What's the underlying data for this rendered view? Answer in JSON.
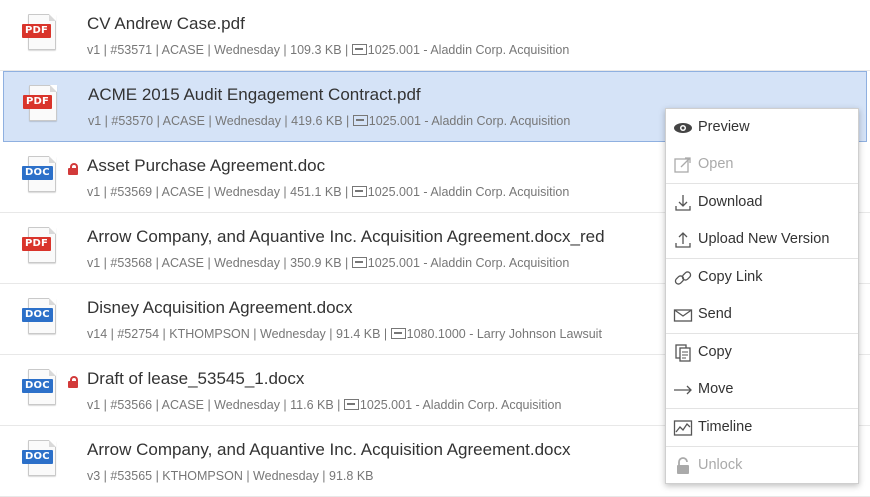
{
  "files": [
    {
      "badge": "PDF",
      "type": "pdf",
      "locked": false,
      "selected": false,
      "title": "CV Andrew Case.pdf",
      "meta_pre": "v1 | #53571 | ACASE | Wednesday | 109.3 KB | ",
      "meta_post": "1025.001 - Aladdin Corp. Acquisition"
    },
    {
      "badge": "PDF",
      "type": "pdf",
      "locked": false,
      "selected": true,
      "title": "ACME 2015 Audit Engagement Contract.pdf",
      "meta_pre": "v1 | #53570 | ACASE | Wednesday | 419.6 KB | ",
      "meta_post": "1025.001 - Aladdin Corp. Acquisition"
    },
    {
      "badge": "DOC",
      "type": "doc",
      "locked": true,
      "selected": false,
      "title": "Asset Purchase Agreement.doc",
      "meta_pre": "v1 | #53569 | ACASE | Wednesday | 451.1 KB | ",
      "meta_post": "1025.001 - Aladdin Corp. Acquisition"
    },
    {
      "badge": "PDF",
      "type": "pdf",
      "locked": false,
      "selected": false,
      "title": "Arrow Company, and Aquantive Inc. Acquisition Agreement.docx_red",
      "meta_pre": "v1 | #53568 | ACASE | Wednesday | 350.9 KB | ",
      "meta_post": "1025.001 - Aladdin Corp. Acquisition"
    },
    {
      "badge": "DOC",
      "type": "doc",
      "locked": false,
      "selected": false,
      "title": "Disney Acquisition Agreement.docx",
      "meta_pre": "v14 | #52754 | KTHOMPSON | Wednesday | 91.4 KB | ",
      "meta_post": "1080.1000 - Larry Johnson Lawsuit"
    },
    {
      "badge": "DOC",
      "type": "doc",
      "locked": true,
      "selected": false,
      "title": "Draft of lease_53545_1.docx",
      "meta_pre": "v1 | #53566 | ACASE | Wednesday | 11.6 KB | ",
      "meta_post": "1025.001 - Aladdin Corp. Acquisition"
    },
    {
      "badge": "DOC",
      "type": "doc",
      "locked": false,
      "selected": false,
      "title": "Arrow Company, and Aquantive Inc. Acquisition Agreement.docx",
      "meta_pre": "v3 | #53565 | KTHOMPSON | Wednesday | 91.8 KB",
      "meta_post": ""
    }
  ],
  "menu": [
    {
      "label": "Preview",
      "icon": "eye-icon",
      "disabled": false,
      "sep": false
    },
    {
      "label": "Open",
      "icon": "open-external-icon",
      "disabled": true,
      "sep": false
    },
    {
      "label": "Download",
      "icon": "download-icon",
      "disabled": false,
      "sep": true
    },
    {
      "label": "Upload New Version",
      "icon": "upload-icon",
      "disabled": false,
      "sep": false
    },
    {
      "label": "Copy Link",
      "icon": "link-icon",
      "disabled": false,
      "sep": true
    },
    {
      "label": "Send",
      "icon": "envelope-icon",
      "disabled": false,
      "sep": false
    },
    {
      "label": "Copy",
      "icon": "copy-icon",
      "disabled": false,
      "sep": true
    },
    {
      "label": "Move",
      "icon": "arrow-right-icon",
      "disabled": false,
      "sep": false
    },
    {
      "label": "Timeline",
      "icon": "timeline-chart-icon",
      "disabled": false,
      "sep": true
    },
    {
      "label": "Unlock",
      "icon": "unlock-icon",
      "disabled": true,
      "sep": true
    }
  ],
  "colors": {
    "pdf_badge": "#d9342b",
    "doc_badge": "#2c70c9",
    "lock": "#d23a3a",
    "selected_bg": "#d5e3f7",
    "selected_border": "#8fb0e0"
  }
}
